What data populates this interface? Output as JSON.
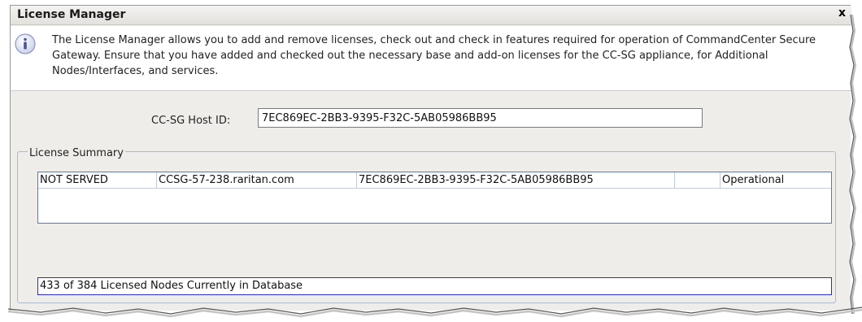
{
  "window": {
    "title": "License Manager",
    "close_label": "x"
  },
  "info": {
    "icon": "info-icon",
    "text": "The License Manager allows you to add and remove licenses, check out and check in features required for operation of CommandCenter Secure Gateway. Ensure that you have added and checked out the necessary base and add-on licenses for the CC-SG appliance, for Additional Nodes/Interfaces, and services."
  },
  "host": {
    "label": "CC-SG Host ID:",
    "value": "7EC869EC-2BB3-9395-F32C-5AB05986BB95"
  },
  "summary": {
    "legend": "License Summary",
    "rows": [
      {
        "served": "NOT SERVED",
        "server": "CCSG-57-238.raritan.com",
        "host_id": "7EC869EC-2BB3-9395-F32C-5AB05986BB95",
        "blank": "",
        "status": "Operational"
      }
    ],
    "nodes_status": "433 of 384 Licensed Nodes Currently in Database"
  },
  "colors": {
    "panel_bg": "#efedea",
    "group_border": "#a8bad3",
    "table_border": "#5a78b8",
    "status_border": "#2a2ac0"
  }
}
